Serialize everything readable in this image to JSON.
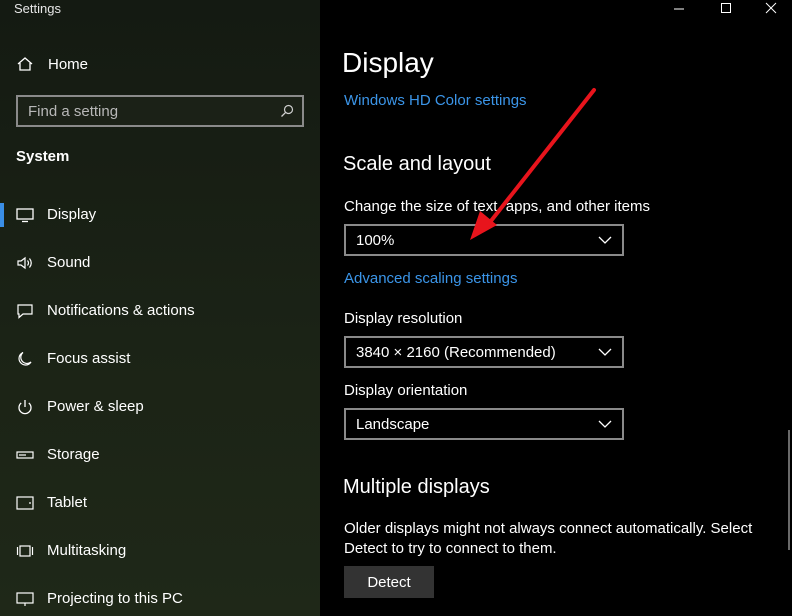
{
  "window": {
    "title": "Settings",
    "controls": [
      "minimize-icon",
      "maximize-icon",
      "close-icon"
    ]
  },
  "sidebar": {
    "home_label": "Home",
    "search_placeholder": "Find a setting",
    "section": "System",
    "items": [
      {
        "label": "Display",
        "icon": "monitor-icon",
        "active": true
      },
      {
        "label": "Sound",
        "icon": "speaker-icon"
      },
      {
        "label": "Notifications & actions",
        "icon": "message-icon"
      },
      {
        "label": "Focus assist",
        "icon": "moon-icon"
      },
      {
        "label": "Power & sleep",
        "icon": "power-icon"
      },
      {
        "label": "Storage",
        "icon": "storage-icon"
      },
      {
        "label": "Tablet",
        "icon": "tablet-icon"
      },
      {
        "label": "Multitasking",
        "icon": "multitasking-icon"
      },
      {
        "label": "Projecting to this PC",
        "icon": "projecting-icon"
      }
    ]
  },
  "main": {
    "page_title": "Display",
    "hd_color_link": "Windows HD Color settings",
    "scale_heading": "Scale and layout",
    "scale_label": "Change the size of text, apps, and other items",
    "scale_value": "100%",
    "advanced_link": "Advanced scaling settings",
    "resolution_label": "Display resolution",
    "resolution_value": "3840 × 2160 (Recommended)",
    "orientation_label": "Display orientation",
    "orientation_value": "Landscape",
    "multiple_heading": "Multiple displays",
    "multiple_text": "Older displays might not always connect automatically. Select Detect to try to connect to them.",
    "detect_label": "Detect"
  },
  "colors": {
    "accent": "#3b95e8",
    "annotation_arrow": "#e8141c"
  }
}
